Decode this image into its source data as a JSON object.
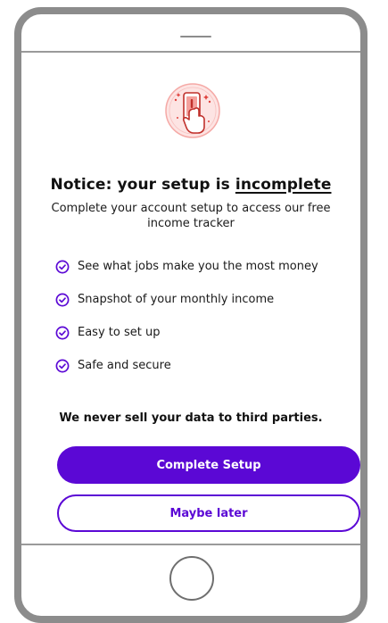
{
  "notice": {
    "headline_prefix": "Notice: your setup is ",
    "headline_emphasis": "incomplete",
    "subhead": "Complete your account setup to access our free income tracker"
  },
  "benefits": [
    {
      "text": "See what jobs make you the most money",
      "icon": "check-circle-icon"
    },
    {
      "text": "Snapshot of your monthly income",
      "icon": "check-circle-icon"
    },
    {
      "text": "Easy to set up",
      "icon": "check-circle-icon"
    },
    {
      "text": "Safe and secure",
      "icon": "check-circle-icon"
    }
  ],
  "privacy_note": "We never sell your data to third parties.",
  "actions": {
    "primary_label": "Complete Setup",
    "secondary_label": "Maybe later"
  },
  "hero": {
    "icon": "phone-alert-hand-icon"
  },
  "colors": {
    "brand": "#5b08d5",
    "hero_bg": "#fde4e3",
    "hero_accent": "#e0413c",
    "device_frame": "#8c8c8c"
  }
}
